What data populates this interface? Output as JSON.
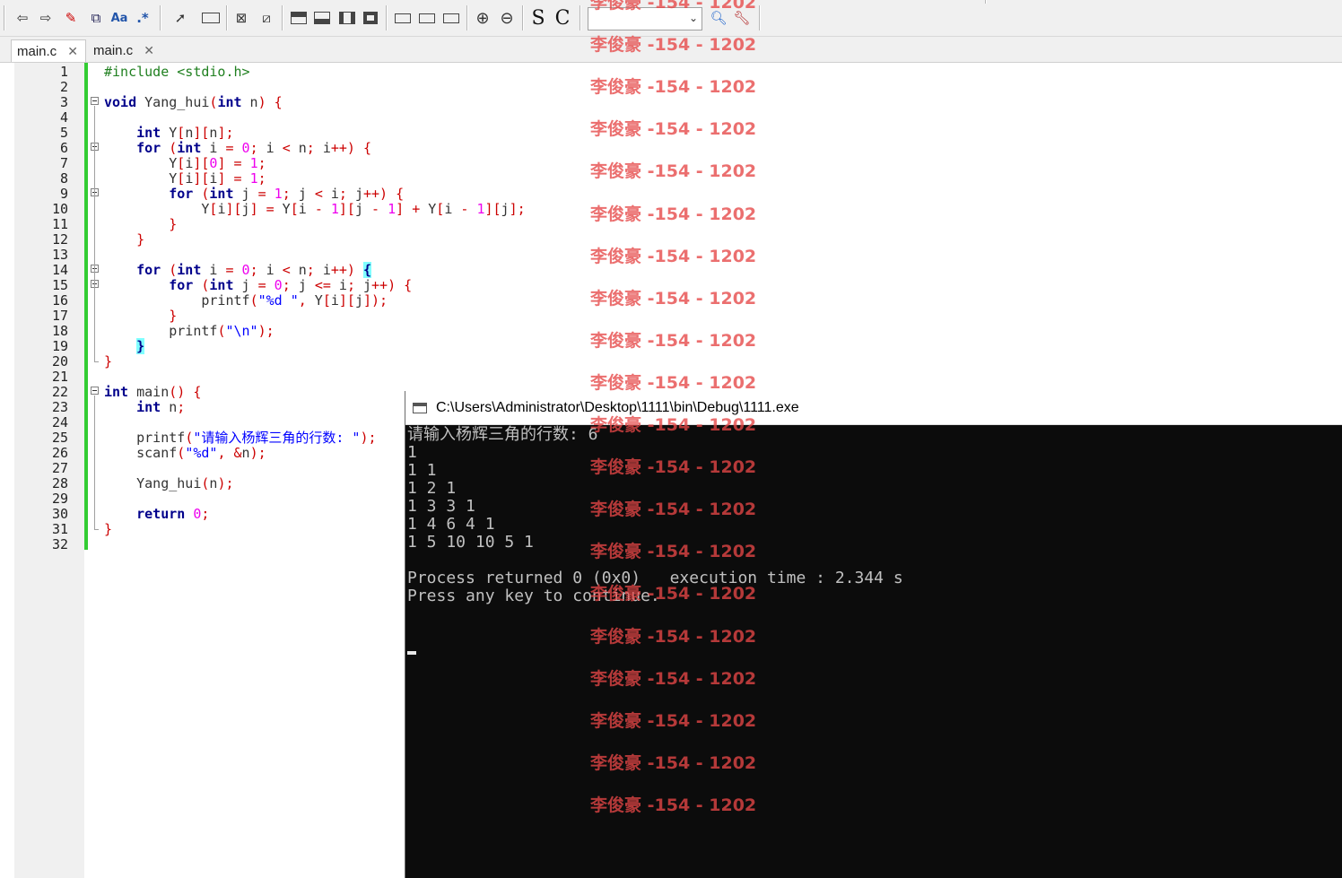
{
  "toolbar": {
    "icons": [
      "back-arrow-icon",
      "forward-arrow-icon",
      "highlight-icon",
      "replace-icon",
      "match-case-icon",
      "regex-icon",
      "select-arrow-icon",
      "rectangle-icon",
      "box-cross-icon",
      "box-slash-icon",
      "layout-1-icon",
      "layout-2-icon",
      "layout-3-icon",
      "layout-4-icon",
      "shape-1-icon",
      "shape-2-icon",
      "shape-3-icon",
      "zoom-in-icon",
      "zoom-out-icon",
      "s-icon",
      "c-icon",
      "search-magnifier-icon",
      "wrench-icon"
    ],
    "glyph_aa": "Aa",
    "glyph_regex": ".*",
    "glyph_s": "S",
    "glyph_c": "C",
    "combo_value": ""
  },
  "tabs": [
    {
      "label": "main.c",
      "close": "✕",
      "active": true
    },
    {
      "label": "main.c",
      "close": "✕",
      "active": false
    }
  ],
  "editor": {
    "line_numbers": [
      "1",
      "2",
      "3",
      "4",
      "5",
      "6",
      "7",
      "8",
      "9",
      "10",
      "11",
      "12",
      "13",
      "14",
      "15",
      "16",
      "17",
      "18",
      "19",
      "20",
      "21",
      "22",
      "23",
      "24",
      "25",
      "26",
      "27",
      "28",
      "29",
      "30",
      "31",
      "32"
    ]
  },
  "console": {
    "title": "C:\\Users\\Administrator\\Desktop\\1111\\bin\\Debug\\1111.exe",
    "lines": [
      "请输入杨辉三角的行数: 6",
      "1",
      "1 1",
      "1 2 1",
      "1 3 3 1",
      "1 4 6 4 1",
      "1 5 10 10 5 1",
      "",
      "Process returned 0 (0x0)   execution time : 2.344 s",
      "Press any key to continue."
    ]
  },
  "watermark": {
    "text": "李俊豪 -154 - 1202",
    "repeat": 20
  }
}
